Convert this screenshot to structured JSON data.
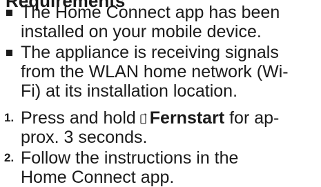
{
  "requirements": {
    "heading": "Requirements",
    "bullets": [
      {
        "lines": [
          "The Home Connect app has been",
          "installed on your mobile device."
        ]
      },
      {
        "lines": [
          "The appliance is receiving signals",
          "from the WLAN home network (Wi-",
          "Fi) at its installation location."
        ]
      }
    ]
  },
  "steps": [
    {
      "number": "1.",
      "line1_pre": "Press and hold",
      "icon": "remote-start-icon",
      "button_label": "Fernstart",
      "line1_post": "for ap-",
      "line2": "prox. 3 seconds."
    },
    {
      "number": "2.",
      "lines": [
        "Follow the instructions in the",
        "Home Connect app."
      ]
    }
  ]
}
